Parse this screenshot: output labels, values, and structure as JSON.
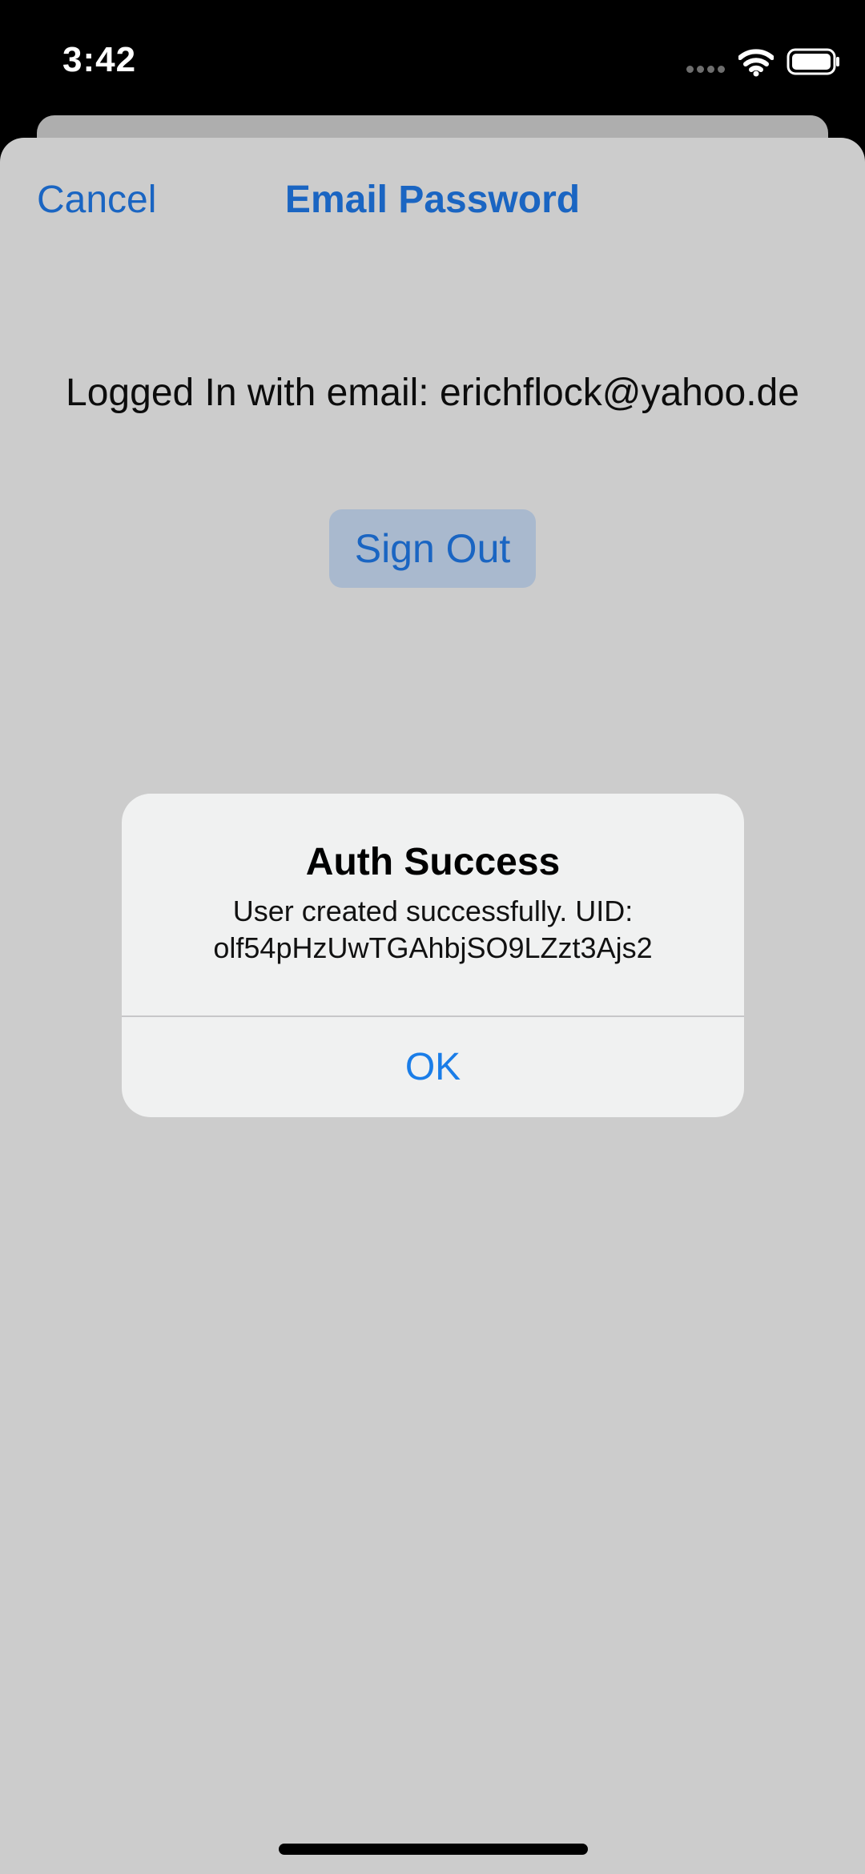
{
  "status_bar": {
    "time": "3:42",
    "icons": [
      "signal-dots-icon",
      "wifi-icon",
      "battery-icon"
    ]
  },
  "nav": {
    "cancel_label": "Cancel",
    "title": "Email Password"
  },
  "main": {
    "logged_in_text": "Logged In with email: erichflock@yahoo.de",
    "sign_out_label": "Sign Out"
  },
  "alert": {
    "title": "Auth Success",
    "message_line1": "User created successfully. UID:",
    "message_line2": "olf54pHzUwTGAhbjSO9LZzt3Ajs2",
    "ok_label": "OK"
  },
  "colors": {
    "accent": "#1a65c2",
    "alert_button": "#1a7de8",
    "sheet_background": "#cccccc",
    "alert_background": "#f0f1f1",
    "sign_out_button_background": "#a9b9ce"
  }
}
